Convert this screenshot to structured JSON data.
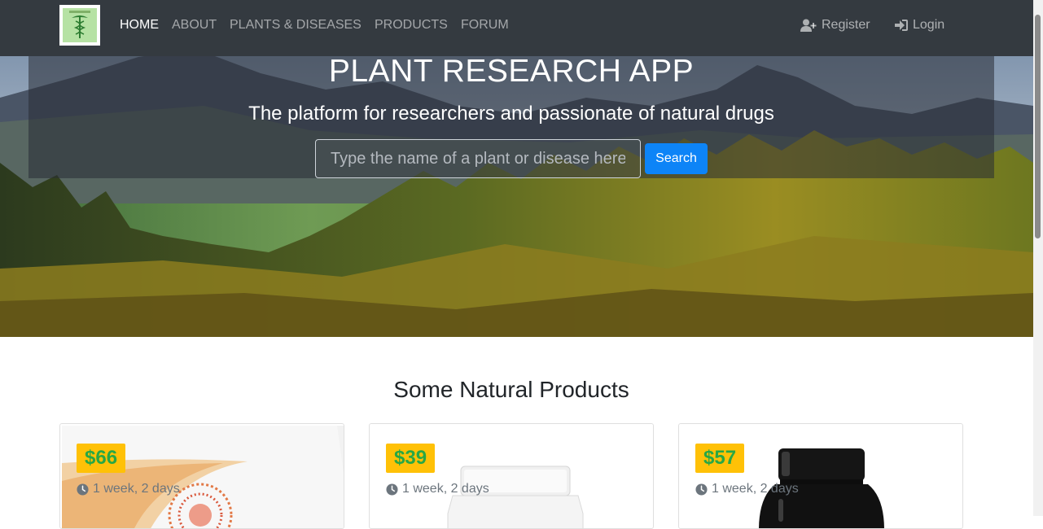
{
  "navbar": {
    "logo_icon": "caduceus-logo",
    "links": [
      {
        "label": "HOME",
        "active": true
      },
      {
        "label": "ABOUT",
        "active": false
      },
      {
        "label": "PLANTS & DISEASES",
        "active": false
      },
      {
        "label": "PRODUCTS",
        "active": false
      },
      {
        "label": "FORUM",
        "active": false
      }
    ],
    "register_label": "Register",
    "register_icon": "user-plus-icon",
    "login_label": "Login",
    "login_icon": "sign-in-icon"
  },
  "hero": {
    "title": "PLANT RESEARCH APP",
    "subtitle": "The platform for researchers and passionate of natural drugs",
    "search": {
      "placeholder": "Type the name of a plant or disease here",
      "value": "",
      "button_label": "Search"
    }
  },
  "products": {
    "heading": "Some Natural Products",
    "items": [
      {
        "price": "$66",
        "age": "1 week, 2 days",
        "clock_icon": "clock-icon"
      },
      {
        "price": "$39",
        "age": "1 week, 2 days",
        "clock_icon": "clock-icon"
      },
      {
        "price": "$57",
        "age": "1 week, 2 days",
        "clock_icon": "clock-icon"
      }
    ]
  },
  "colors": {
    "navbar_bg": "#343a40",
    "primary_button": "#0d84f7",
    "price_badge_bg": "#ffc107",
    "price_text": "#28a745"
  }
}
